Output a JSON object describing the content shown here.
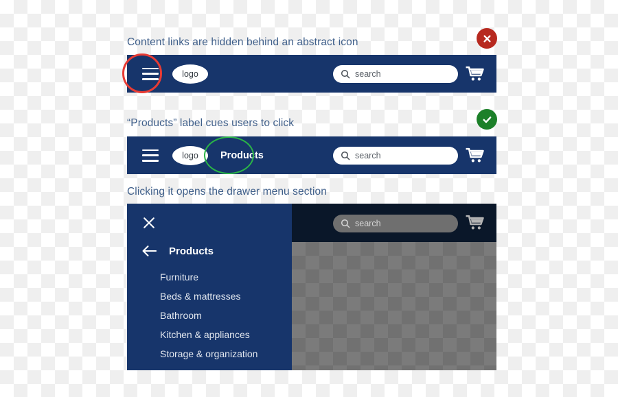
{
  "sections": [
    {
      "caption": "Content links are hidden behind an abstract icon",
      "badge": "error-badge",
      "navbar": {
        "menu_icon": "hamburger-icon",
        "logo": "logo",
        "search_placeholder": "search",
        "search_icon": "search-icon",
        "cart_icon": "cart-icon"
      },
      "annotation": "red-highlight-ring"
    },
    {
      "caption": "“Products” label cues users to click",
      "badge": "success-badge",
      "navbar": {
        "menu_icon": "hamburger-icon",
        "logo": "logo",
        "nav_link": "Products",
        "search_placeholder": "search",
        "search_icon": "search-icon",
        "cart_icon": "cart-icon"
      },
      "annotation": "green-highlight-ring"
    },
    {
      "caption": "Clicking it opens the drawer menu section",
      "drawer": {
        "close_icon": "close-icon",
        "back_icon": "back-arrow-icon",
        "title": "Products",
        "items": [
          "Furniture",
          "Beds & mattresses",
          "Bathroom",
          "Kitchen & appliances",
          "Storage & organization"
        ]
      },
      "scrim": {
        "search_placeholder": "search",
        "search_icon": "search-icon",
        "cart_icon": "cart-icon"
      }
    }
  ],
  "colors": {
    "navy": "#17356b",
    "error": "#b7291f",
    "success": "#1c8029",
    "ring_red": "#e83b34",
    "ring_green": "#2ab447",
    "caption": "#3f5f8a"
  }
}
